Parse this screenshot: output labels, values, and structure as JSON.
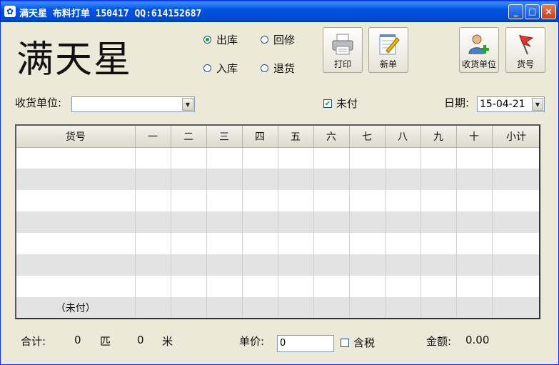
{
  "window": {
    "title": "满天星 布料打单 150417 QQ:614152687",
    "controls": {
      "minimize": "_",
      "maximize": "□",
      "close": "×"
    }
  },
  "brand": {
    "title": "满天星"
  },
  "modes": [
    {
      "label": "出库",
      "selected": true
    },
    {
      "label": "回修",
      "selected": false
    },
    {
      "label": "入库",
      "selected": false
    },
    {
      "label": "退货",
      "selected": false
    }
  ],
  "toolbar": {
    "print_label": "打印",
    "new_label": "新单",
    "receiver_unit_label": "收货单位",
    "item_no_label": "货号"
  },
  "form": {
    "receiver_label": "收货单位:",
    "receiver_value": "",
    "unpaid_label": "未付",
    "unpaid_checked": true,
    "date_label": "日期:",
    "date_value": "15-04-21"
  },
  "table": {
    "headers": [
      "货号",
      "一",
      "二",
      "三",
      "四",
      "五",
      "六",
      "七",
      "八",
      "九",
      "十",
      "小计"
    ],
    "rows": [
      [
        "",
        "",
        "",
        "",
        "",
        "",
        "",
        "",
        "",
        "",
        "",
        ""
      ],
      [
        "",
        "",
        "",
        "",
        "",
        "",
        "",
        "",
        "",
        "",
        "",
        ""
      ],
      [
        "",
        "",
        "",
        "",
        "",
        "",
        "",
        "",
        "",
        "",
        "",
        ""
      ],
      [
        "",
        "",
        "",
        "",
        "",
        "",
        "",
        "",
        "",
        "",
        "",
        ""
      ],
      [
        "",
        "",
        "",
        "",
        "",
        "",
        "",
        "",
        "",
        "",
        "",
        ""
      ],
      [
        "",
        "",
        "",
        "",
        "",
        "",
        "",
        "",
        "",
        "",
        "",
        ""
      ],
      [
        "",
        "",
        "",
        "",
        "",
        "",
        "",
        "",
        "",
        "",
        "",
        ""
      ],
      [
        "（未付）",
        "",
        "",
        "",
        "",
        "",
        "",
        "",
        "",
        "",
        "",
        ""
      ]
    ]
  },
  "footer": {
    "total_label": "合计:",
    "pieces_count": "0",
    "pieces_unit": "匹",
    "meters_count": "0",
    "meters_unit": "米",
    "unit_price_label": "单价:",
    "unit_price_value": "0",
    "tax_label": "含税",
    "tax_checked": false,
    "amount_label": "金额:",
    "amount_value": "0.00"
  },
  "colors": {
    "titlebar": "#0054e3",
    "window_bg": "#ece9d8",
    "row_alt": "#e3e3e3"
  }
}
